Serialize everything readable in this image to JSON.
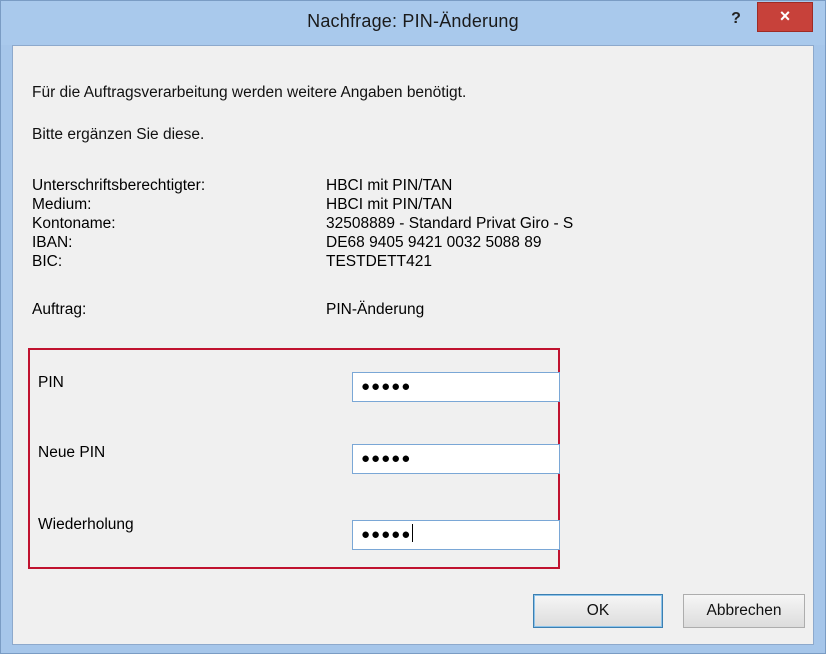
{
  "window": {
    "title": "Nachfrage: PIN-Änderung",
    "help_label": "?",
    "close_label": "×"
  },
  "intro": {
    "line1": "Für die Auftragsverarbeitung werden weitere Angaben benötigt.",
    "line2": "Bitte ergänzen Sie diese."
  },
  "info": [
    {
      "label": "Unterschriftsberechtigter:",
      "value": "HBCI mit PIN/TAN"
    },
    {
      "label": "Medium:",
      "value": "HBCI mit PIN/TAN"
    },
    {
      "label": "Kontoname:",
      "value": "32508889 - Standard Privat Giro - S"
    },
    {
      "label": "IBAN:",
      "value": "DE68 9405 9421 0032 5088 89"
    },
    {
      "label": "BIC:",
      "value": "TESTDETT421"
    }
  ],
  "auftrag": {
    "label": "Auftrag:",
    "value": "PIN-Änderung"
  },
  "fields": {
    "pin": {
      "label": "PIN",
      "value": "●●●●●"
    },
    "new_pin": {
      "label": "Neue PIN",
      "value": "●●●●●"
    },
    "repeat": {
      "label": "Wiederholung",
      "value": "●●●●●"
    }
  },
  "buttons": {
    "ok": "OK",
    "cancel": "Abbrechen"
  },
  "colors": {
    "title_bar": "#a9c9ec",
    "close_button": "#c7413a",
    "highlight_box": "#c0122f"
  }
}
